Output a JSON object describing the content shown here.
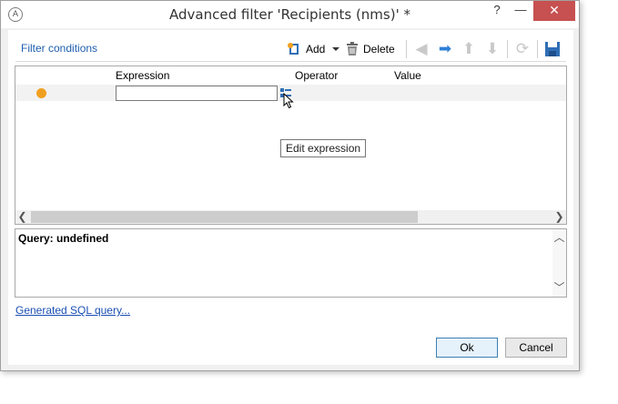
{
  "window": {
    "title": "Advanced filter 'Recipients (nms)' *",
    "help_label": "?",
    "minimize_label": "—",
    "close_label": "✕"
  },
  "toolbar": {
    "section_title": "Filter conditions",
    "add_label": "Add",
    "delete_label": "Delete",
    "icons": [
      "add-icon",
      "dropdown-arrow-icon",
      "delete-icon",
      "arrow-left-icon",
      "arrow-right-icon",
      "arrow-up-icon",
      "arrow-down-icon",
      "refresh-icon",
      "save-icon"
    ]
  },
  "grid": {
    "columns": [
      "Expression",
      "Operator",
      "Value"
    ],
    "rows": [
      {
        "status": "pending",
        "expression": "",
        "operator": "",
        "value": ""
      }
    ]
  },
  "tooltip": {
    "text": "Edit expression"
  },
  "query": {
    "text": "Query: undefined"
  },
  "links": {
    "generated_sql": "Generated SQL query..."
  },
  "buttons": {
    "ok": "Ok",
    "cancel": "Cancel"
  },
  "colors": {
    "accent_link": "#1a4fb5",
    "section_title": "#1f5fb0",
    "status_dot": "#f0a020",
    "close_button": "#c75050"
  }
}
